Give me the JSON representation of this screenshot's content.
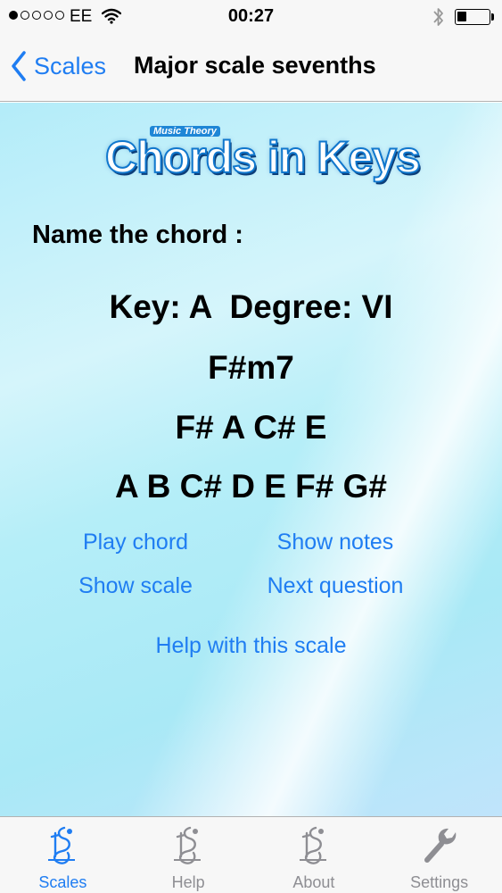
{
  "status": {
    "carrier": "EE",
    "time": "00:27",
    "signal_bars_filled": 1,
    "signal_bars_total": 5,
    "battery_level": 0.3
  },
  "nav": {
    "back_label": "Scales",
    "title": "Major scale sevenths"
  },
  "logo": {
    "small": "Music Theory",
    "main": "Chords in Keys"
  },
  "quiz": {
    "prompt": "Name the chord :",
    "key_degree": "Key: A  Degree: VI",
    "chord": "F#m7",
    "chord_notes": "F# A C# E",
    "scale_notes": "A B C# D E F# G#"
  },
  "actions": {
    "play_chord": "Play chord",
    "show_notes": "Show notes",
    "show_scale": "Show scale",
    "next_question": "Next question",
    "help": "Help with this scale"
  },
  "tabs": [
    {
      "label": "Scales",
      "icon": "scales-icon",
      "active": true
    },
    {
      "label": "Help",
      "icon": "help-icon",
      "active": false
    },
    {
      "label": "About",
      "icon": "about-icon",
      "active": false
    },
    {
      "label": "Settings",
      "icon": "wrench-icon",
      "active": false
    }
  ],
  "colors": {
    "accent": "#1f7df2",
    "tab_inactive": "#8e8e93",
    "background": "#b3ecf9"
  }
}
